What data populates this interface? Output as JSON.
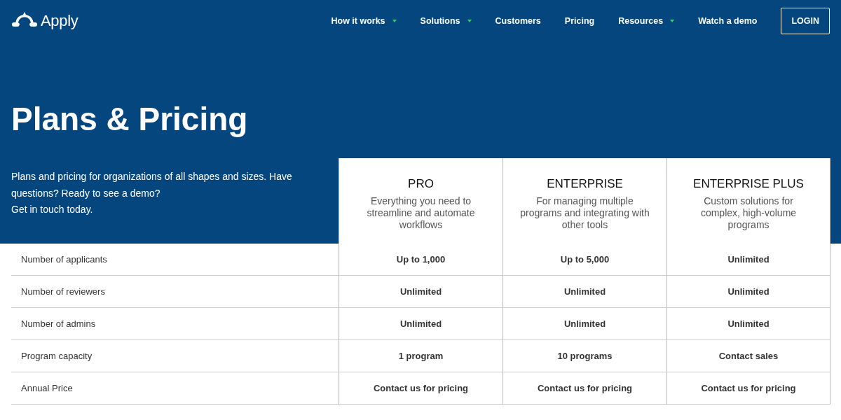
{
  "logo": {
    "text": "Apply"
  },
  "nav": [
    {
      "label": "How it works",
      "has_menu": true
    },
    {
      "label": "Solutions",
      "has_menu": true
    },
    {
      "label": "Customers",
      "has_menu": false
    },
    {
      "label": "Pricing",
      "has_menu": false
    },
    {
      "label": "Resources",
      "has_menu": true
    },
    {
      "label": "Watch a demo",
      "has_menu": false
    }
  ],
  "login_button": "LOGIN",
  "title": "Plans & Pricing",
  "intro": [
    "Plans and pricing for organizations of all shapes and sizes. Have questions? Ready to see a demo?",
    "Get in touch today."
  ],
  "plans": [
    {
      "name": "PRO",
      "description": "Everything you need to streamline and automate workflows"
    },
    {
      "name": "ENTERPRISE",
      "description": "For managing multiple programs and integrating with other tools"
    },
    {
      "name": "ENTERPRISE PLUS",
      "description": "Custom solutions for complex, high-volume programs"
    }
  ],
  "rows": [
    {
      "feature": "Number of applicants",
      "values": [
        "Up to 1,000",
        "Up to 5,000",
        "Unlimited"
      ]
    },
    {
      "feature": "Number of reviewers",
      "values": [
        "Unlimited",
        "Unlimited",
        "Unlimited"
      ]
    },
    {
      "feature": "Number of admins",
      "values": [
        "Unlimited",
        "Unlimited",
        "Unlimited"
      ]
    },
    {
      "feature": "Program capacity",
      "values": [
        "1 program",
        "10 programs",
        "Contact sales"
      ]
    },
    {
      "feature": "Annual Price",
      "values": [
        "Contact us for pricing",
        "Contact us for pricing",
        "Contact us for pricing"
      ]
    }
  ]
}
